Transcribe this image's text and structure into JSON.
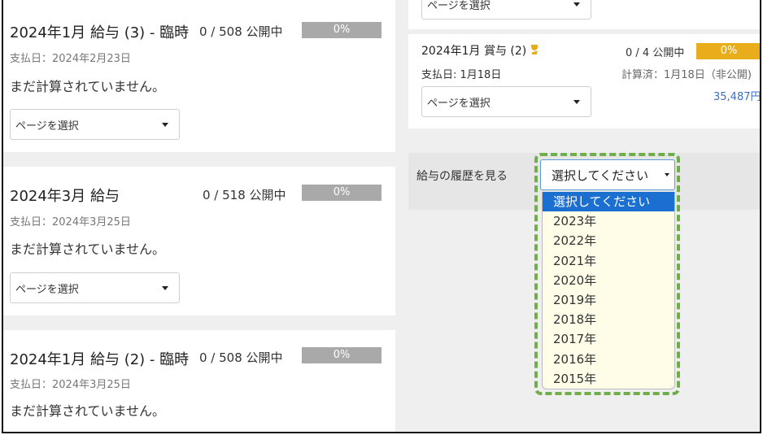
{
  "cards_left": [
    {
      "title": "2024年1月 給与 (3) - 臨時",
      "count": "0 / 508 公開中",
      "badge": "0%",
      "pay_date": "支払日：2024年2月23日",
      "status": "まだ計算されていません。",
      "select": "ページを選択"
    },
    {
      "title": "2024年3月 給与",
      "count": "0 / 518 公開中",
      "badge": "0%",
      "pay_date": "支払日：2024年3月25日",
      "status": "まだ計算されていません。",
      "select": "ページを選択"
    },
    {
      "title": "2024年1月 給与 (2) - 臨時",
      "count": "0 / 508 公開中",
      "badge": "0%",
      "pay_date": "支払日：2024年3月25日",
      "status": "まだ計算されていません。"
    }
  ],
  "top_right": {
    "select": "ページを選択"
  },
  "bonus_card": {
    "title": "2024年1月 賞与 (2)",
    "trophy_icon": "trophy-icon",
    "count": "0 / 4 公開中",
    "badge": "0%",
    "badge_color": "#e9ad1b",
    "pay_date": "支払日: 1月18日",
    "calculated": "計算済：1月18日（非公開)",
    "amount": "35,487円",
    "select": "ページを選択"
  },
  "history": {
    "label": "給与の履歴を見る",
    "selected": "選択してください",
    "options": [
      "選択してください",
      "2023年",
      "2022年",
      "2021年",
      "2020年",
      "2019年",
      "2018年",
      "2017年",
      "2016年",
      "2015年"
    ]
  },
  "colors": {
    "accent": "#1b6fd1",
    "highlight_outline": "#6fae49",
    "badge_grey": "#a9a9a9",
    "link_blue": "#3a6fc4"
  }
}
